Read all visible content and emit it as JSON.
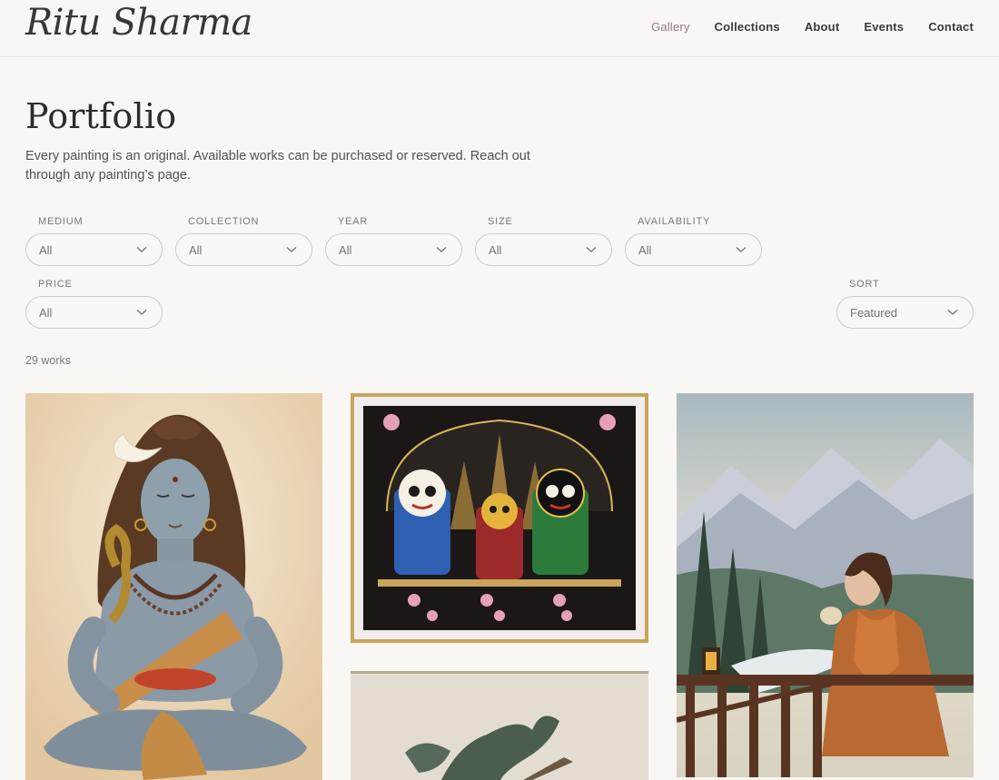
{
  "header": {
    "logo": "Ritu Sharma",
    "nav": [
      "Gallery",
      "Collections",
      "About",
      "Events",
      "Contact"
    ],
    "active_nav": "Gallery"
  },
  "page": {
    "title": "Portfolio",
    "intro": "Every painting is an original. Available works can be purchased or reserved. Reach out through any painting’s page."
  },
  "filters": {
    "medium": {
      "label": "MEDIUM",
      "value": "All"
    },
    "collection": {
      "label": "COLLECTION",
      "value": "All"
    },
    "year": {
      "label": "YEAR",
      "value": "All"
    },
    "size": {
      "label": "SIZE",
      "value": "All"
    },
    "availability": {
      "label": "AVAILABILITY",
      "value": "All"
    },
    "price": {
      "label": "PRICE",
      "value": "All"
    },
    "sort": {
      "label": "SORT",
      "value": "Featured"
    }
  },
  "results": {
    "count_text": "29 works"
  },
  "colors": {
    "background": "#f9f7f3",
    "nav_active": "#9b7b80",
    "border": "#cfcbc5"
  },
  "icons": {
    "select_arrow": "chevron-down-icon"
  }
}
